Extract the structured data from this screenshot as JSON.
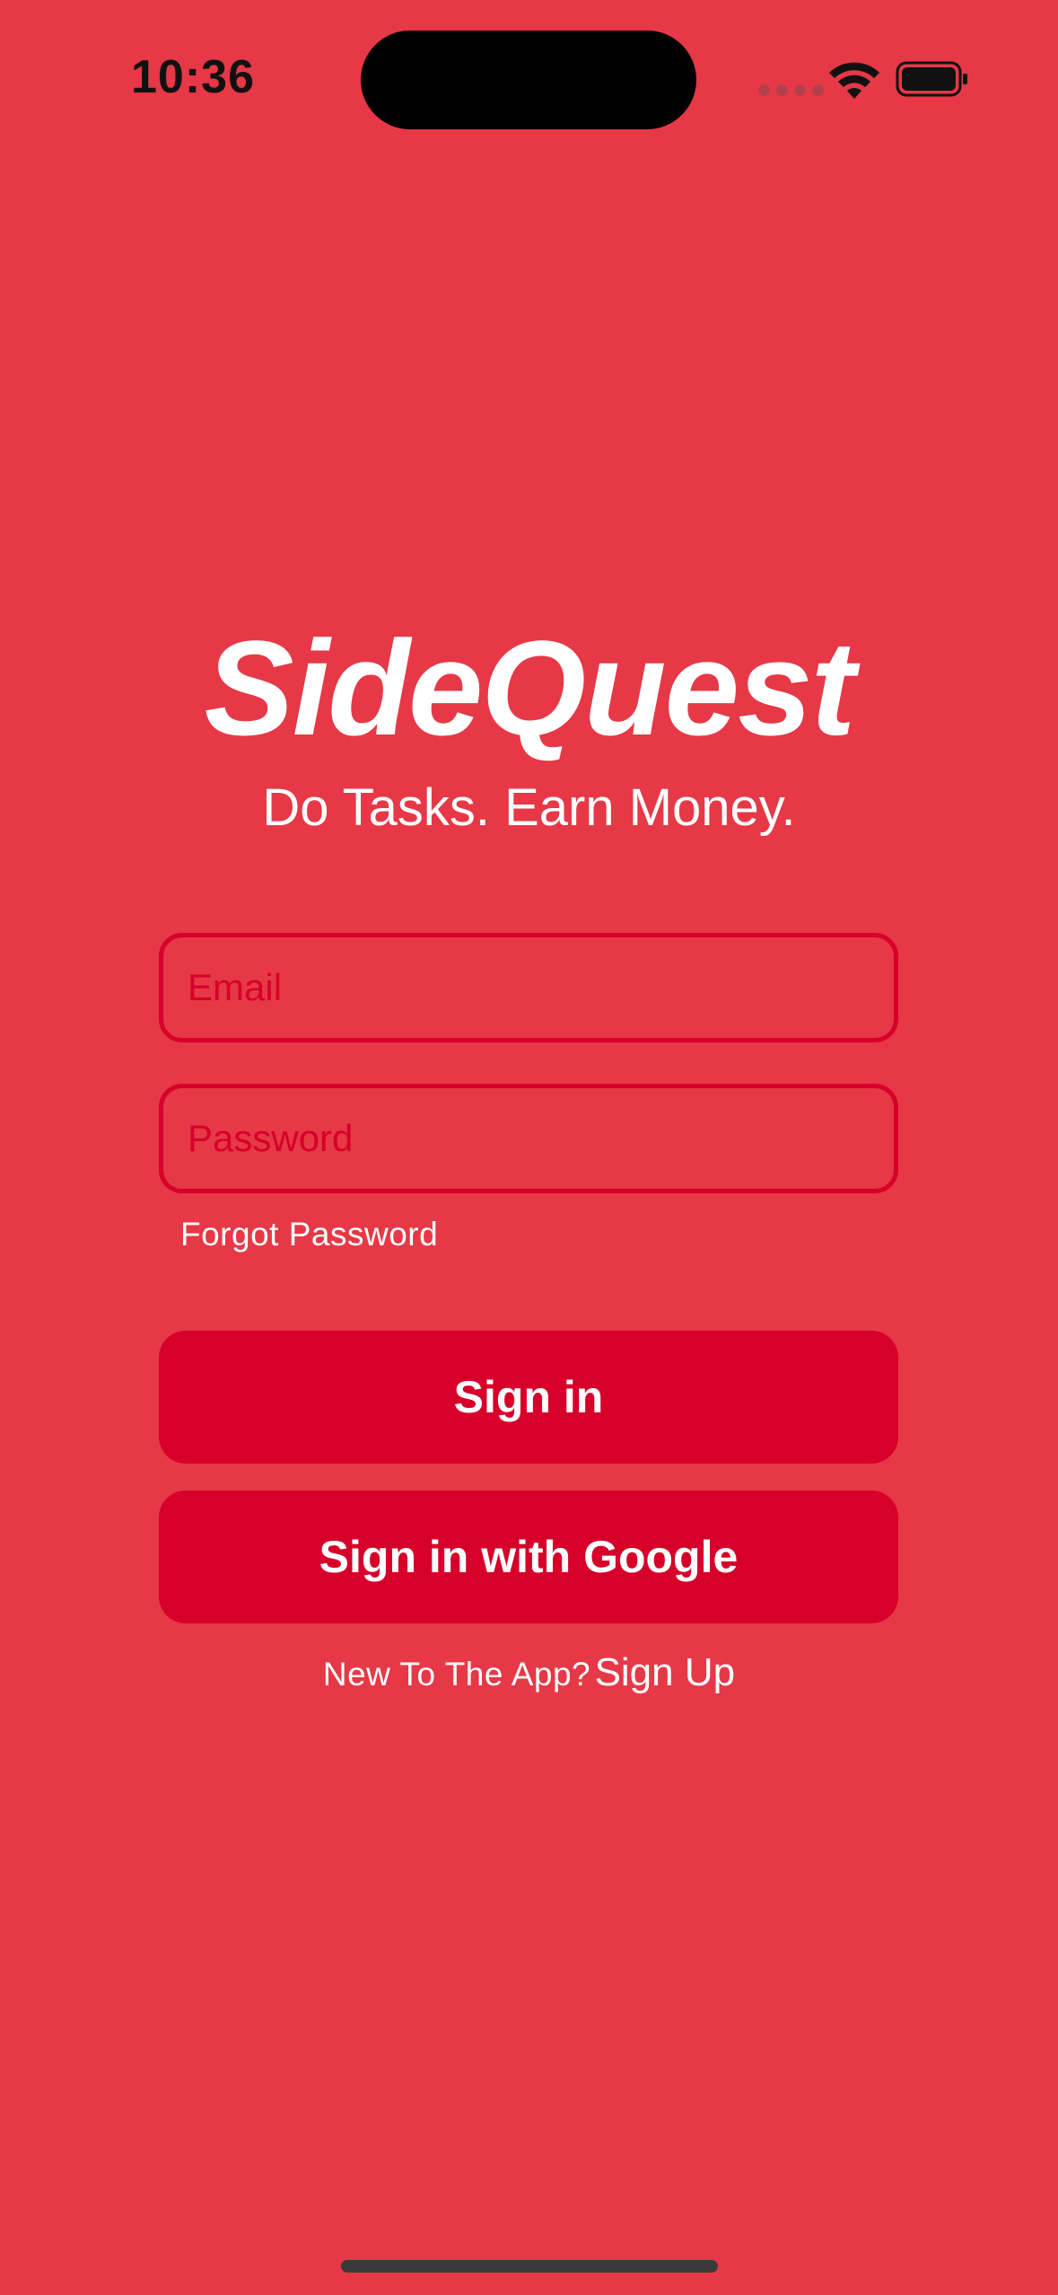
{
  "status_bar": {
    "time": "10:36",
    "icons": [
      "cellular-signal-icon",
      "wifi-icon",
      "battery-icon"
    ]
  },
  "app": {
    "title": "SideQuest",
    "tagline": "Do Tasks. Earn Money."
  },
  "form": {
    "email_placeholder": "Email",
    "email_value": "",
    "password_placeholder": "Password",
    "password_value": "",
    "forgot_password_label": "Forgot Password",
    "sign_in_label": "Sign in",
    "google_sign_in_label": "Sign in with Google",
    "signup_prompt": "New To The App?",
    "signup_link": "Sign Up"
  },
  "colors": {
    "background": "#e63846",
    "button": "#d6002a",
    "field_border": "#d6002a",
    "text": "#ffffff"
  }
}
